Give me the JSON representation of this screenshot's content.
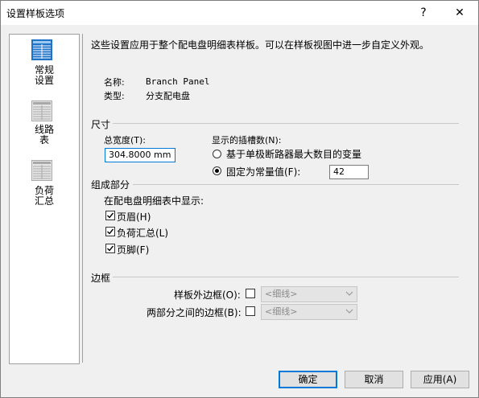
{
  "window": {
    "title": "设置样板选项",
    "help_label": "?",
    "close_label": "✕"
  },
  "nav": {
    "items": [
      {
        "label": "常规设置",
        "icon": "table-icon",
        "selected": true
      },
      {
        "label": "线路表",
        "icon": "table-icon",
        "selected": false
      },
      {
        "label": "负荷汇总",
        "icon": "table-icon",
        "selected": false
      }
    ]
  },
  "main": {
    "description": "这些设置应用于整个配电盘明细表样板。可以在样板视图中进一步自定义外观。",
    "name_label": "名称:",
    "name_value": "Branch Panel",
    "type_label": "类型:",
    "type_value": "分支配电盘"
  },
  "size": {
    "title": "尺寸",
    "total_width_label": "总宽度(T):",
    "total_width_value": "304.8000 mm",
    "slots_label": "显示的插槽数(N):",
    "option_variable": "基于单极断路器最大数目的变量",
    "option_fixed": "固定为常量值(F):",
    "fixed_value": "42",
    "selected_option": "fixed"
  },
  "components": {
    "title": "组成部分",
    "show_label": "在配电盘明细表中显示:",
    "header_label": "页眉(H)",
    "load_summary_label": "负荷汇总(L)",
    "footer_label": "页脚(F)",
    "header_checked": true,
    "load_summary_checked": true,
    "footer_checked": true
  },
  "borders": {
    "title": "边框",
    "outer_label": "样板外边框(O):",
    "outer_value": "<细线>",
    "between_label": "两部分之间的边框(B):",
    "between_value": "<细线>"
  },
  "buttons": {
    "ok": "确定",
    "cancel": "取消",
    "apply": "应用(A)"
  },
  "colors": {
    "accent": "#0078d7",
    "icon_blue": "#1e73c8",
    "icon_gray": "#a8a8a8"
  }
}
